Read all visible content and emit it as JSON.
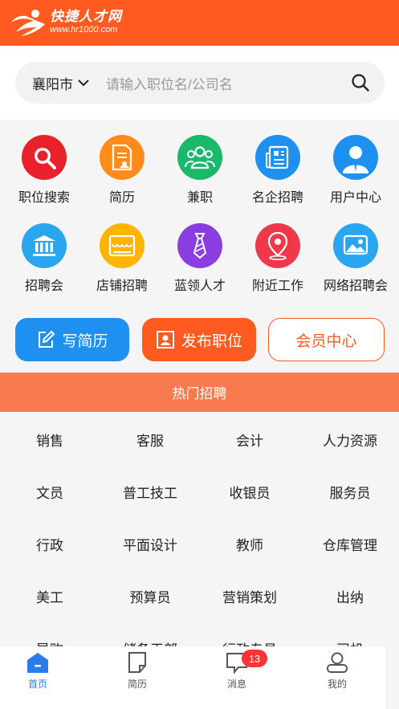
{
  "header": {
    "logo_name": "快捷人才网",
    "logo_url": "www.hr1000.com",
    "brand_color": "#ff5a1f"
  },
  "search": {
    "city": "襄阳市",
    "placeholder": "请输入职位名/公司名"
  },
  "grid": [
    {
      "label": "职位搜索",
      "icon": "magnifier-icon",
      "color": "#e8212a"
    },
    {
      "label": "简历",
      "icon": "resume-icon",
      "color": "#ff8c1a"
    },
    {
      "label": "兼职",
      "icon": "people-icon",
      "color": "#19b86b"
    },
    {
      "label": "名企招聘",
      "icon": "newspaper-icon",
      "color": "#1e90f0"
    },
    {
      "label": "用户中心",
      "icon": "user-icon",
      "color": "#1e90f0"
    },
    {
      "label": "招聘会",
      "icon": "bank-icon",
      "color": "#2aa6f0"
    },
    {
      "label": "店铺招聘",
      "icon": "shop-icon",
      "color": "#ffb400"
    },
    {
      "label": "蓝领人才",
      "icon": "tie-icon",
      "color": "#8a3ee0"
    },
    {
      "label": "附近工作",
      "icon": "location-pin-icon",
      "color": "#f0384b"
    },
    {
      "label": "网络招聘会",
      "icon": "picture-icon",
      "color": "#2aa6f0"
    }
  ],
  "buttons": {
    "write_resume": "写简历",
    "post_job": "发布职位",
    "member_center": "会员中心"
  },
  "hot": {
    "title": "热门招聘",
    "rows": [
      [
        "销售",
        "客服",
        "会计",
        "人力资源"
      ],
      [
        "文员",
        "普工技工",
        "收银员",
        "服务员"
      ],
      [
        "行政",
        "平面设计",
        "教师",
        "仓库管理"
      ],
      [
        "美工",
        "预算员",
        "营销策划",
        "出纳"
      ],
      [
        "导购",
        "储备干部",
        "行政专员",
        "司机"
      ]
    ]
  },
  "tabbar": {
    "tabs": [
      {
        "label": "首页",
        "icon": "home-icon",
        "active": true
      },
      {
        "label": "简历",
        "icon": "document-icon",
        "active": false
      },
      {
        "label": "消息",
        "icon": "message-icon",
        "active": false,
        "badge": "13"
      },
      {
        "label": "我的",
        "icon": "profile-icon",
        "active": false
      }
    ],
    "active_color": "#2b7be8"
  }
}
